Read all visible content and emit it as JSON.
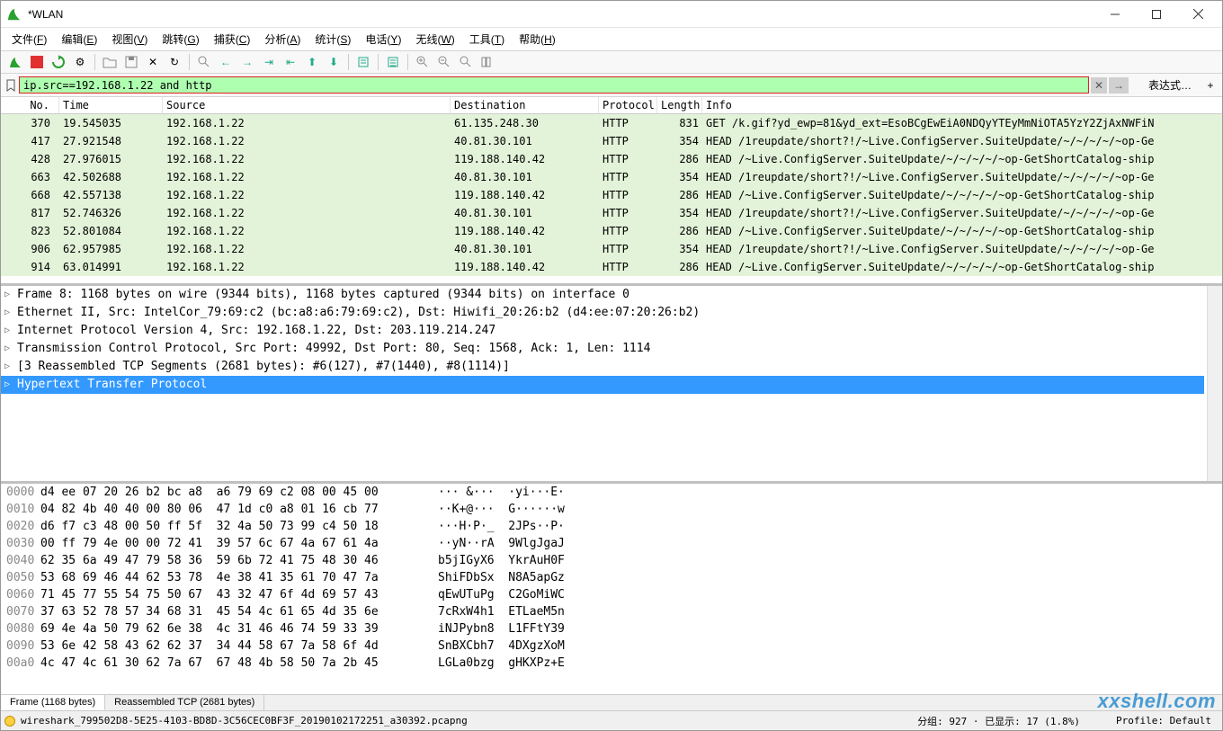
{
  "title": "*WLAN",
  "menus": [
    "文件(F)",
    "编辑(E)",
    "视图(V)",
    "跳转(G)",
    "捕获(C)",
    "分析(A)",
    "统计(S)",
    "电话(Y)",
    "无线(W)",
    "工具(T)",
    "帮助(H)"
  ],
  "filter_value": "ip.src==192.168.1.22 and http",
  "expr_button": "表达式…",
  "columns": {
    "no": "No.",
    "time": "Time",
    "source": "Source",
    "destination": "Destination",
    "protocol": "Protocol",
    "length": "Length",
    "info": "Info"
  },
  "packets": [
    {
      "no": "370",
      "time": "19.545035",
      "src": "192.168.1.22",
      "dst": "61.135.248.30",
      "prot": "HTTP",
      "len": "831",
      "info": "GET /k.gif?yd_ewp=81&yd_ext=EsoBCgEwEiA0NDQyYTEyMmNiOTA5YzY2ZjAxNWFiN"
    },
    {
      "no": "417",
      "time": "27.921548",
      "src": "192.168.1.22",
      "dst": "40.81.30.101",
      "prot": "HTTP",
      "len": "354",
      "info": "HEAD /1reupdate/short?!/~Live.ConfigServer.SuiteUpdate/~/~/~/~/~op-Ge"
    },
    {
      "no": "428",
      "time": "27.976015",
      "src": "192.168.1.22",
      "dst": "119.188.140.42",
      "prot": "HTTP",
      "len": "286",
      "info": "HEAD /~Live.ConfigServer.SuiteUpdate/~/~/~/~/~op-GetShortCatalog-ship"
    },
    {
      "no": "663",
      "time": "42.502688",
      "src": "192.168.1.22",
      "dst": "40.81.30.101",
      "prot": "HTTP",
      "len": "354",
      "info": "HEAD /1reupdate/short?!/~Live.ConfigServer.SuiteUpdate/~/~/~/~/~op-Ge"
    },
    {
      "no": "668",
      "time": "42.557138",
      "src": "192.168.1.22",
      "dst": "119.188.140.42",
      "prot": "HTTP",
      "len": "286",
      "info": "HEAD /~Live.ConfigServer.SuiteUpdate/~/~/~/~/~op-GetShortCatalog-ship"
    },
    {
      "no": "817",
      "time": "52.746326",
      "src": "192.168.1.22",
      "dst": "40.81.30.101",
      "prot": "HTTP",
      "len": "354",
      "info": "HEAD /1reupdate/short?!/~Live.ConfigServer.SuiteUpdate/~/~/~/~/~op-Ge"
    },
    {
      "no": "823",
      "time": "52.801084",
      "src": "192.168.1.22",
      "dst": "119.188.140.42",
      "prot": "HTTP",
      "len": "286",
      "info": "HEAD /~Live.ConfigServer.SuiteUpdate/~/~/~/~/~op-GetShortCatalog-ship"
    },
    {
      "no": "906",
      "time": "62.957985",
      "src": "192.168.1.22",
      "dst": "40.81.30.101",
      "prot": "HTTP",
      "len": "354",
      "info": "HEAD /1reupdate/short?!/~Live.ConfigServer.SuiteUpdate/~/~/~/~/~op-Ge"
    },
    {
      "no": "914",
      "time": "63.014991",
      "src": "192.168.1.22",
      "dst": "119.188.140.42",
      "prot": "HTTP",
      "len": "286",
      "info": "HEAD /~Live.ConfigServer.SuiteUpdate/~/~/~/~/~op-GetShortCatalog-ship"
    }
  ],
  "details": [
    "Frame 8: 1168 bytes on wire (9344 bits), 1168 bytes captured (9344 bits) on interface 0",
    "Ethernet II, Src: IntelCor_79:69:c2 (bc:a8:a6:79:69:c2), Dst: Hiwifi_20:26:b2 (d4:ee:07:20:26:b2)",
    "Internet Protocol Version 4, Src: 192.168.1.22, Dst: 203.119.214.247",
    "Transmission Control Protocol, Src Port: 49992, Dst Port: 80, Seq: 1568, Ack: 1, Len: 1114",
    "[3 Reassembled TCP Segments (2681 bytes): #6(127), #7(1440), #8(1114)]",
    "Hypertext Transfer Protocol"
  ],
  "hex": [
    {
      "off": "0000",
      "h": "d4 ee 07 20 26 b2 bc a8  a6 79 69 c2 08 00 45 00",
      "a": "··· &···  ·yi···E·"
    },
    {
      "off": "0010",
      "h": "04 82 4b 40 40 00 80 06  47 1d c0 a8 01 16 cb 77",
      "a": "··K+@···  G······w"
    },
    {
      "off": "0020",
      "h": "d6 f7 c3 48 00 50 ff 5f  32 4a 50 73 99 c4 50 18",
      "a": "···H·P·_  2JPs··P·"
    },
    {
      "off": "0030",
      "h": "00 ff 79 4e 00 00 72 41  39 57 6c 67 4a 67 61 4a",
      "a": "··yN··rA  9WlgJgaJ"
    },
    {
      "off": "0040",
      "h": "62 35 6a 49 47 79 58 36  59 6b 72 41 75 48 30 46",
      "a": "b5jIGyX6  YkrAuH0F"
    },
    {
      "off": "0050",
      "h": "53 68 69 46 44 62 53 78  4e 38 41 35 61 70 47 7a",
      "a": "ShiFDbSx  N8A5apGz"
    },
    {
      "off": "0060",
      "h": "71 45 77 55 54 75 50 67  43 32 47 6f 4d 69 57 43",
      "a": "qEwUTuPg  C2GoMiWC"
    },
    {
      "off": "0070",
      "h": "37 63 52 78 57 34 68 31  45 54 4c 61 65 4d 35 6e",
      "a": "7cRxW4h1  ETLaeM5n"
    },
    {
      "off": "0080",
      "h": "69 4e 4a 50 79 62 6e 38  4c 31 46 46 74 59 33 39",
      "a": "iNJPybn8  L1FFtY39"
    },
    {
      "off": "0090",
      "h": "53 6e 42 58 43 62 62 37  34 44 58 67 7a 58 6f 4d",
      "a": "SnBXCbh7  4DXgzXoM"
    },
    {
      "off": "00a0",
      "h": "4c 47 4c 61 30 62 7a 67  67 48 4b 58 50 7a 2b 45",
      "a": "LGLa0bzg  gHKXPz+E"
    }
  ],
  "bottom_tabs": [
    "Frame (1168 bytes)",
    "Reassembled TCP (2681 bytes)"
  ],
  "status": {
    "file": "wireshark_799502D8-5E25-4103-BD8D-3C56CEC0BF3F_20190102172251_a30392.pcapng",
    "mid": "分组: 927 · 已显示: 17 (1.8%)",
    "right": "Profile: Default"
  },
  "watermark": "xxshell.com"
}
